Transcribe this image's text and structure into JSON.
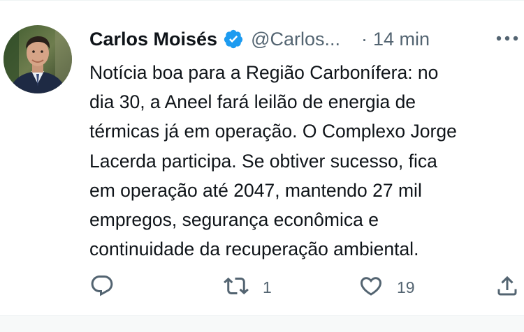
{
  "tweet": {
    "author": {
      "display_name": "Carlos Moisés",
      "handle": "@Carlos...",
      "verified": true,
      "verified_color": "#1d9bf0"
    },
    "separator": "·",
    "timestamp": "14 min",
    "text_lines": [
      "Notícia boa para a Região Carbonífera: no",
      "dia 30, a Aneel fará leilão de energia de",
      "térmicas já em operação. O Complexo Jorge",
      "Lacerda participa. Se obtiver sucesso, fica",
      "em operação até 2047, mantendo 27 mil",
      "empregos, segurança econômica e",
      "continuidade da recuperação ambiental."
    ],
    "actions": {
      "reply": {
        "icon": "reply-icon"
      },
      "retweet": {
        "icon": "retweet-icon",
        "count": "1"
      },
      "like": {
        "icon": "heart-icon",
        "count": "19"
      },
      "share": {
        "icon": "share-icon"
      }
    },
    "more_icon": "more-icon"
  },
  "colors": {
    "text_primary": "#0f1419",
    "text_secondary": "#536471",
    "verified": "#1d9bf0"
  }
}
